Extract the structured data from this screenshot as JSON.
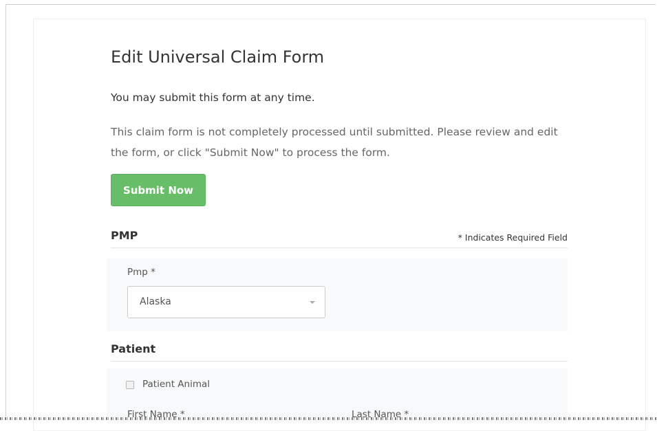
{
  "page": {
    "title": "Edit Universal Claim Form",
    "lead": "You may submit this form at any time.",
    "info": "This claim form is not completely processed until submitted. Please review and edit the form, or click \"Submit Now\" to process the form.",
    "submit_label": "Submit Now"
  },
  "pmp_section": {
    "title": "PMP",
    "required_note": "* Indicates Required Field",
    "field_label": "Pmp *",
    "selected_value": "Alaska"
  },
  "patient_section": {
    "title": "Patient",
    "checkbox_label": "Patient Animal",
    "first_name_label": "First Name *",
    "last_name_label": "Last Name *"
  },
  "colors": {
    "primary_button": "#5cb85c",
    "well_background": "#f8f9fa"
  }
}
